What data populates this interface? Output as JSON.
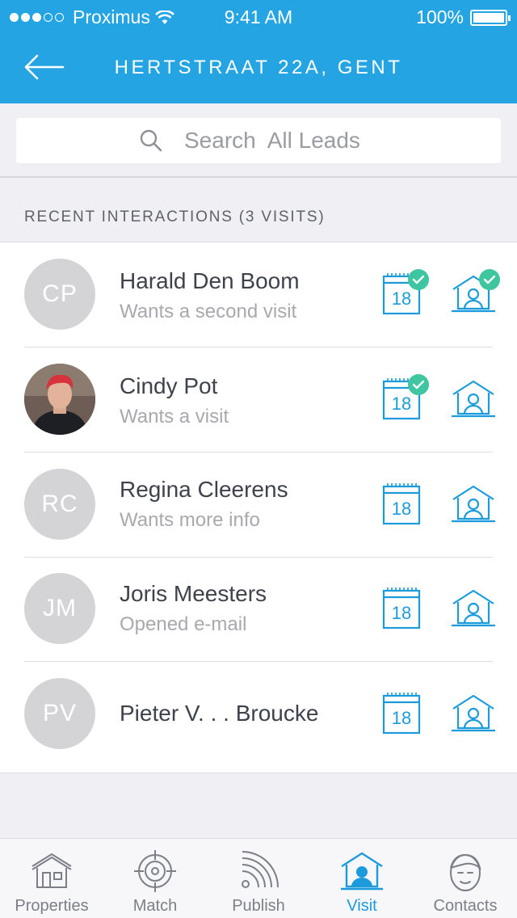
{
  "status_bar": {
    "carrier": "Proximus",
    "time": "9:41 AM",
    "battery": "100%"
  },
  "header": {
    "title": "HERTSTRAAT 22A, GENT"
  },
  "search": {
    "placeholder": "Search  All Leads"
  },
  "section": {
    "label": "RECENT INTERACTIONS (3 VISITS)"
  },
  "leads": [
    {
      "initials": "CP",
      "name": "Harald Den Boom",
      "subtitle": "Wants a second visit",
      "calendar_day": "18",
      "calendar_done": true,
      "visit_done": true
    },
    {
      "initials": "",
      "name": "Cindy Pot",
      "subtitle": "Wants a visit",
      "calendar_day": "18",
      "calendar_done": true,
      "visit_done": false
    },
    {
      "initials": "RC",
      "name": "Regina Cleerens",
      "subtitle": "Wants more info",
      "calendar_day": "18",
      "calendar_done": false,
      "visit_done": false
    },
    {
      "initials": "JM",
      "name": "Joris Meesters",
      "subtitle": "Opened e-mail",
      "calendar_day": "18",
      "calendar_done": false,
      "visit_done": false
    },
    {
      "initials": "PV",
      "name": "Pieter V. . . Broucke",
      "subtitle": "",
      "calendar_day": "18",
      "calendar_done": false,
      "visit_done": false
    }
  ],
  "tabs": [
    {
      "label": "Properties",
      "icon": "house-icon"
    },
    {
      "label": "Match",
      "icon": "target-icon"
    },
    {
      "label": "Publish",
      "icon": "broadcast-icon"
    },
    {
      "label": "Visit",
      "icon": "visit-house-icon"
    },
    {
      "label": "Contacts",
      "icon": "face-icon"
    }
  ],
  "active_tab": "Visit",
  "colors": {
    "header_blue": "#25a4e4",
    "accent_blue": "#1c9bdc",
    "check_green": "#3ec6a0",
    "avatar_gray": "#d4d4d6"
  }
}
